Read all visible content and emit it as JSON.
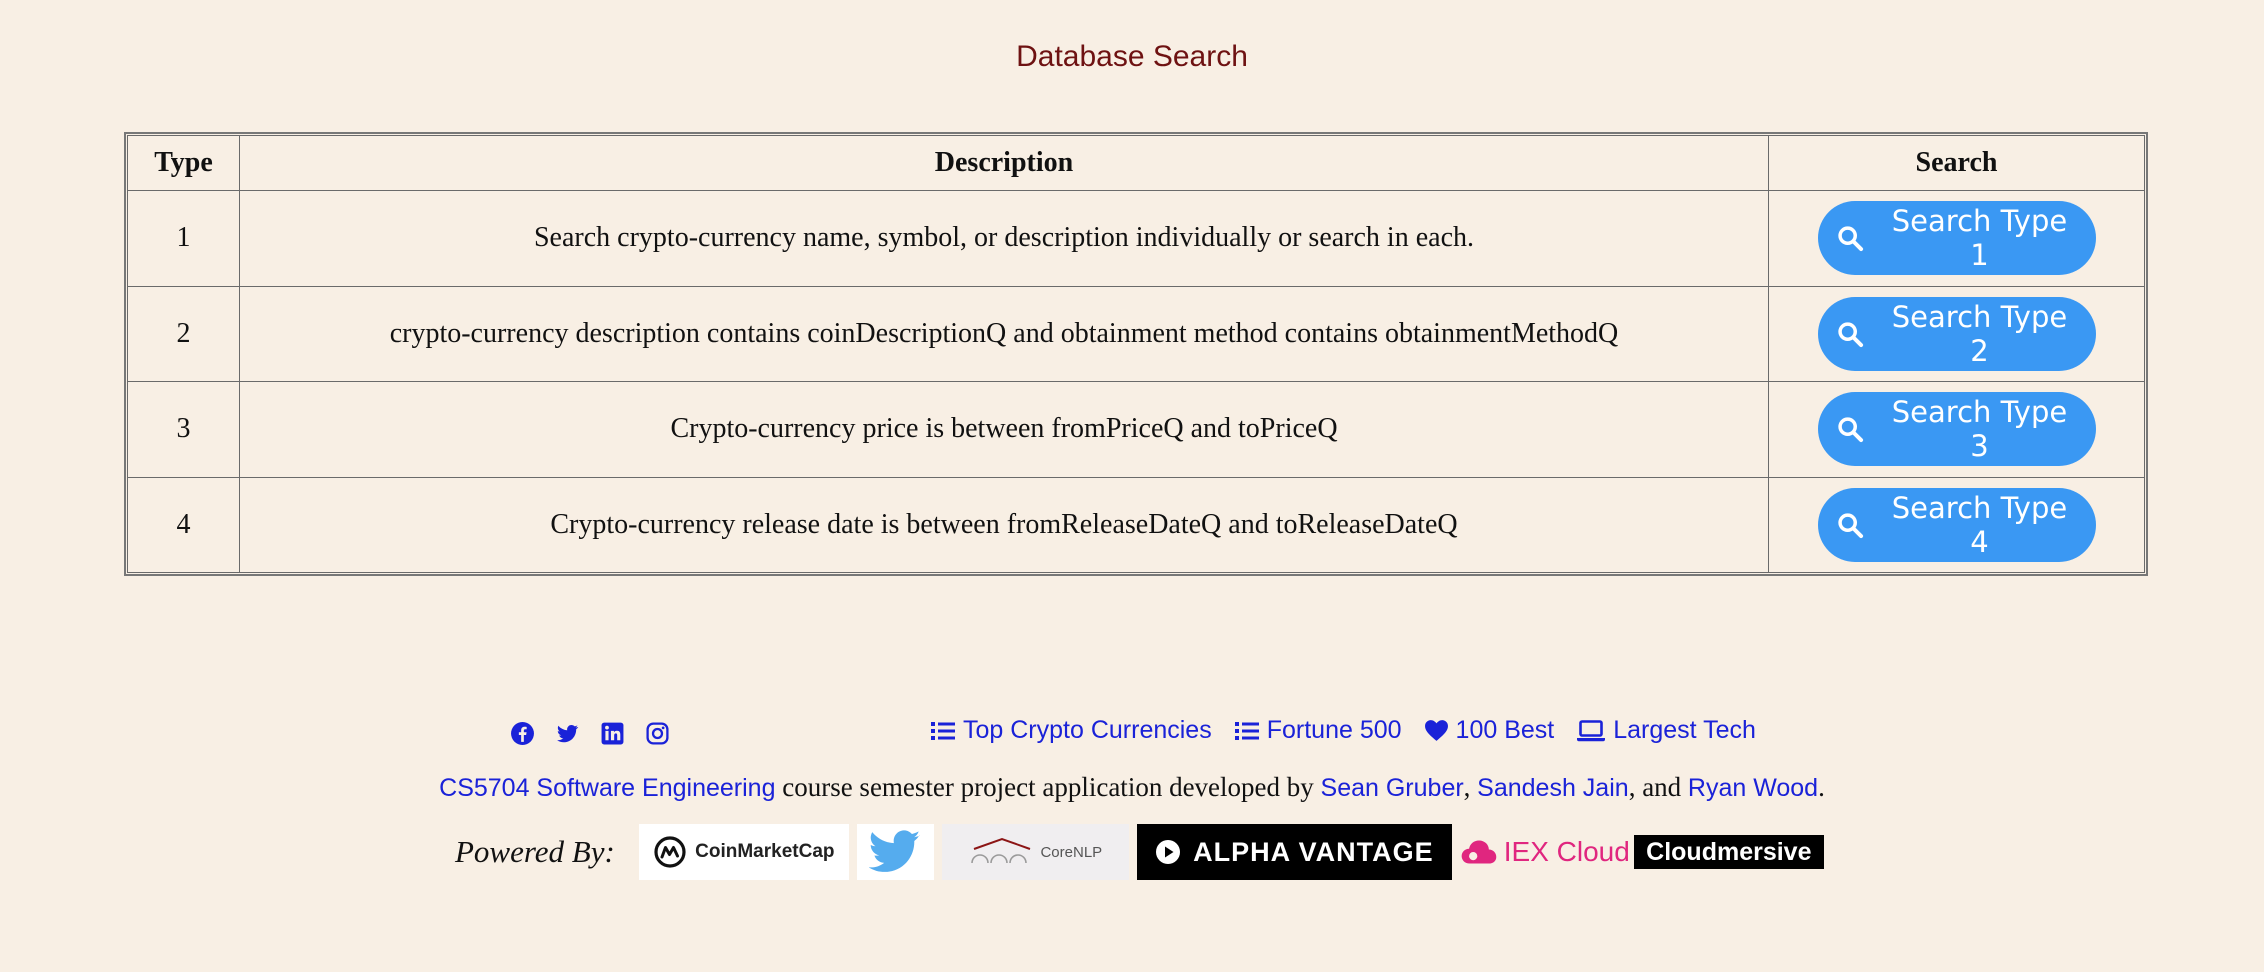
{
  "page": {
    "title": "Database Search"
  },
  "table": {
    "headers": {
      "type": "Type",
      "description": "Description",
      "search": "Search"
    },
    "rows": [
      {
        "type": "1",
        "description": "Search crypto-currency name, symbol, or description individually or search in each.",
        "button": "Search Type 1"
      },
      {
        "type": "2",
        "description": "crypto-currency description contains coinDescriptionQ and obtainment method contains obtainmentMethodQ",
        "button": "Search Type 2"
      },
      {
        "type": "3",
        "description": "Crypto-currency price is between fromPriceQ and toPriceQ",
        "button": "Search Type 3"
      },
      {
        "type": "4",
        "description": "Crypto-currency release date is between fromReleaseDateQ and toReleaseDateQ",
        "button": "Search Type 4"
      }
    ]
  },
  "footer": {
    "social_icons": [
      "facebook-icon",
      "twitter-icon",
      "linkedin-icon",
      "instagram-icon"
    ],
    "nav": [
      {
        "label": "Top Crypto Currencies",
        "icon": "list-icon"
      },
      {
        "label": "Fortune 500",
        "icon": "list-icon"
      },
      {
        "label": "100 Best",
        "icon": "heart-icon"
      },
      {
        "label": "Largest Tech",
        "icon": "laptop-icon"
      }
    ],
    "credits": {
      "course": "CS5704 Software Engineering",
      "text1": " course semester project application developed by ",
      "author1": "Sean Gruber",
      "sep1": ", ",
      "author2": "Sandesh Jain",
      "sep2": ", and ",
      "author3": "Ryan Wood",
      "end": "."
    },
    "powered_by": {
      "label": "Powered By:",
      "logos": {
        "coinmarketcap": "CoinMarketCap",
        "corenlp": "CoreNLP",
        "alphavantage": "ALPHA VANTAGE",
        "iex": "IEX Cloud",
        "cloudmersive": "Cloudmersive"
      }
    }
  },
  "colors": {
    "background": "#f8efe4",
    "title": "#6e1212",
    "button": "#3a98f3",
    "link": "#1a22d8"
  }
}
